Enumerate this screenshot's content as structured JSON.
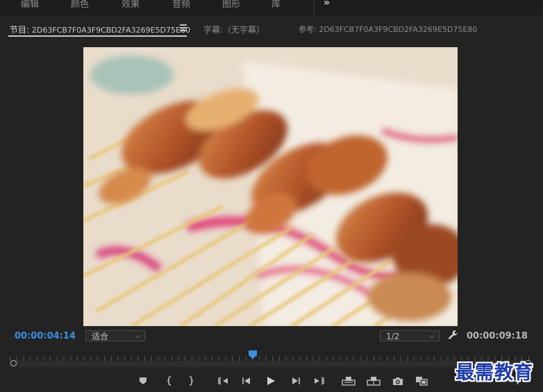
{
  "workspace_tabs": [
    "编辑",
    "颜色",
    "效果",
    "音频",
    "图形",
    "库"
  ],
  "more_label": "»",
  "panel": {
    "program_prefix": "节目:",
    "program_sequence": "2D63FCB7F0A3F9CBD2FA3269E5D75E80",
    "captions_label": "字幕:（无字幕）",
    "reference_label": "参考: 2D63FCB7F0A3F9CBD2FA3269E5D75E80"
  },
  "timecode": {
    "current": "00:00:04:14",
    "duration": "00:00:09:18"
  },
  "zoom": {
    "selected": "适合"
  },
  "resolution": {
    "selected": "1/2"
  },
  "playhead_fraction": 0.465,
  "watermark": "最需教育",
  "colors": {
    "accent_blue": "#3d8fe0",
    "background": "#232323",
    "watermark": "#1f3ba8"
  },
  "icons": [
    "menu-icon",
    "wrench-icon",
    "marker-icon",
    "mark-in-icon",
    "mark-out-icon",
    "go-to-in-icon",
    "step-back-icon",
    "play-icon",
    "step-forward-icon",
    "go-to-out-icon",
    "lift-icon",
    "extract-icon",
    "camera-icon",
    "compare-icon",
    "plus-icon"
  ]
}
